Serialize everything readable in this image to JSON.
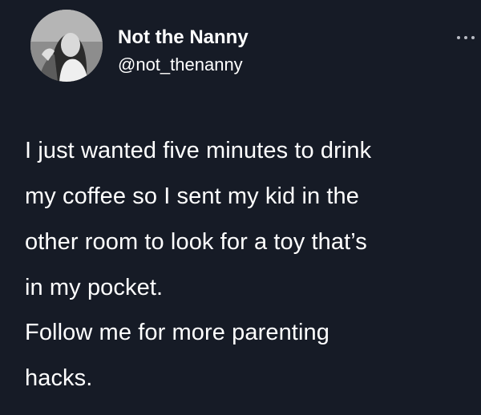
{
  "user": {
    "display_name": "Not the Nanny",
    "handle": "@not_thenanny",
    "avatar_icon": "profile-photo"
  },
  "menu_icon": "more-options-icon",
  "tweet": {
    "paragraph_1": [
      "I just wanted five minutes to drink",
      "my coffee so I sent my kid in the",
      "other room to look for a toy that’s",
      "in my pocket."
    ],
    "paragraph_2": [
      "Follow me for more parenting",
      "hacks."
    ]
  },
  "colors": {
    "background": "#161b26",
    "text": "#ffffff",
    "menu_dots": "#b9bcc4"
  }
}
